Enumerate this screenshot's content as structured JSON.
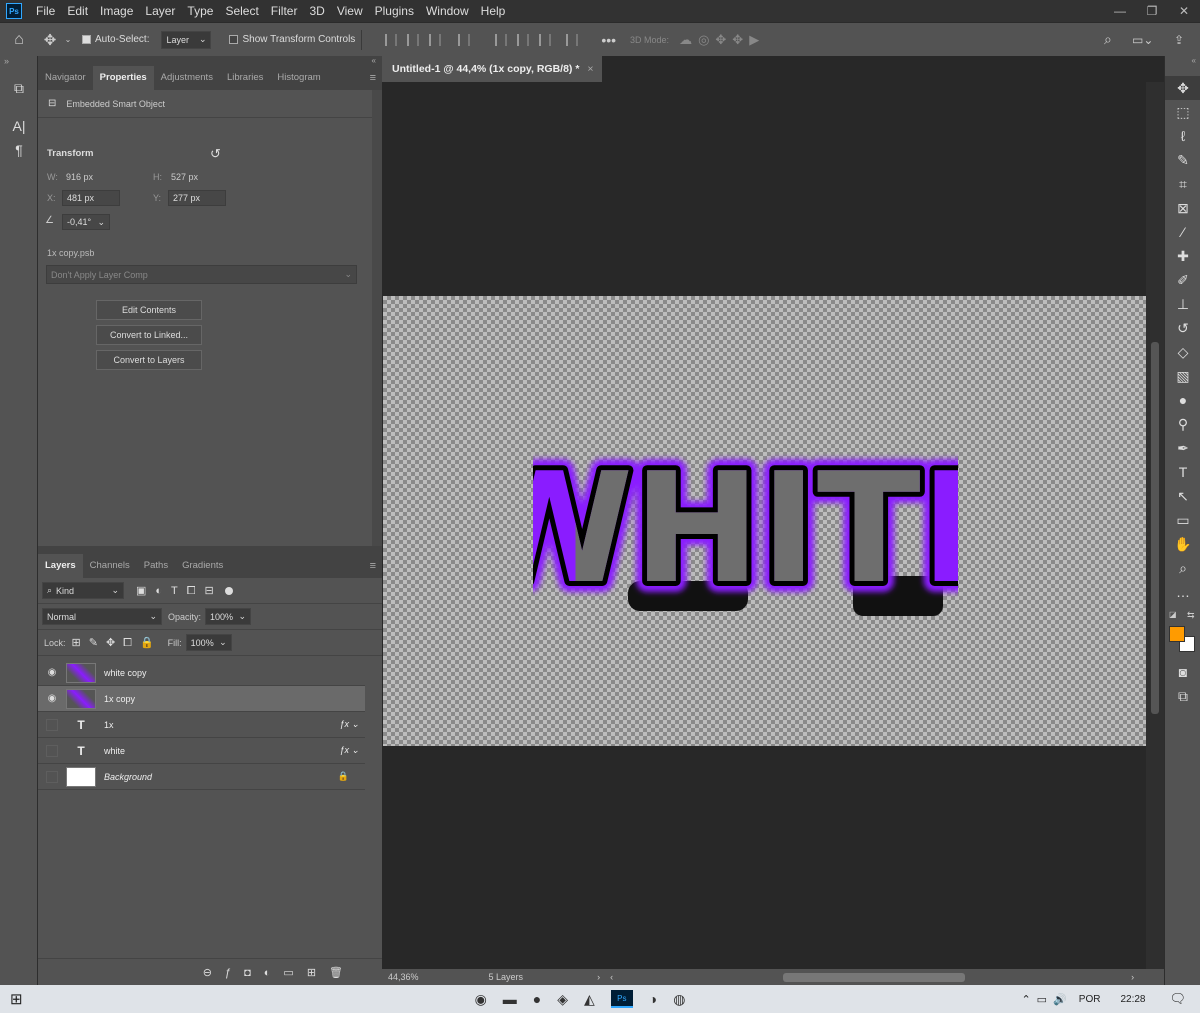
{
  "app": {
    "logo": "Ps"
  },
  "menu": [
    "File",
    "Edit",
    "Image",
    "Layer",
    "Type",
    "Select",
    "Filter",
    "3D",
    "View",
    "Plugins",
    "Window",
    "Help"
  ],
  "options": {
    "auto_select_label": "Auto-Select:",
    "auto_select_value": "Layer",
    "show_transform": "Show Transform Controls",
    "mode_3d": "3D Mode:"
  },
  "properties_tabs": [
    "Navigator",
    "Properties",
    "Adjustments",
    "Libraries",
    "Histogram"
  ],
  "properties": {
    "kind": "Embedded Smart Object",
    "transform_title": "Transform",
    "w_label": "W:",
    "w": "916 px",
    "h_label": "H:",
    "h": "527 px",
    "x_label": "X:",
    "x": "481 px",
    "y_label": "Y:",
    "y": "277 px",
    "angle": "-0,41°",
    "file": "1x copy.psb",
    "layer_comp": "Don't Apply Layer Comp",
    "btn_edit": "Edit Contents",
    "btn_linked": "Convert to Linked...",
    "btn_layers": "Convert to Layers"
  },
  "layers_tabs": [
    "Layers",
    "Channels",
    "Paths",
    "Gradients"
  ],
  "layers_ctrl": {
    "kind": "Kind",
    "blend": "Normal",
    "opacity_label": "Opacity:",
    "opacity": "100%",
    "lock_label": "Lock:",
    "fill_label": "Fill:",
    "fill": "100%"
  },
  "layers": [
    {
      "name": "white copy",
      "visible": true,
      "selected": false,
      "type": "smart",
      "fx": false,
      "lock": false
    },
    {
      "name": "1x copy",
      "visible": true,
      "selected": true,
      "type": "smart",
      "fx": false,
      "lock": false
    },
    {
      "name": "1x",
      "visible": false,
      "selected": false,
      "type": "text",
      "fx": true,
      "lock": false
    },
    {
      "name": "white",
      "visible": false,
      "selected": false,
      "type": "text",
      "fx": true,
      "lock": false
    },
    {
      "name": "Background",
      "visible": false,
      "selected": false,
      "type": "bg",
      "fx": false,
      "lock": true
    }
  ],
  "document": {
    "tab": "Untitled-1 @ 44,4% (1x copy, RGB/8) *",
    "art_text": "WHITE",
    "zoom": "44,36%",
    "status": "5 Layers"
  },
  "colors": {
    "fg": "#ff9b00",
    "bg": "#ffffff",
    "purple": "#8a1cff"
  },
  "taskbar": {
    "lang": "POR",
    "time": "22:28"
  }
}
